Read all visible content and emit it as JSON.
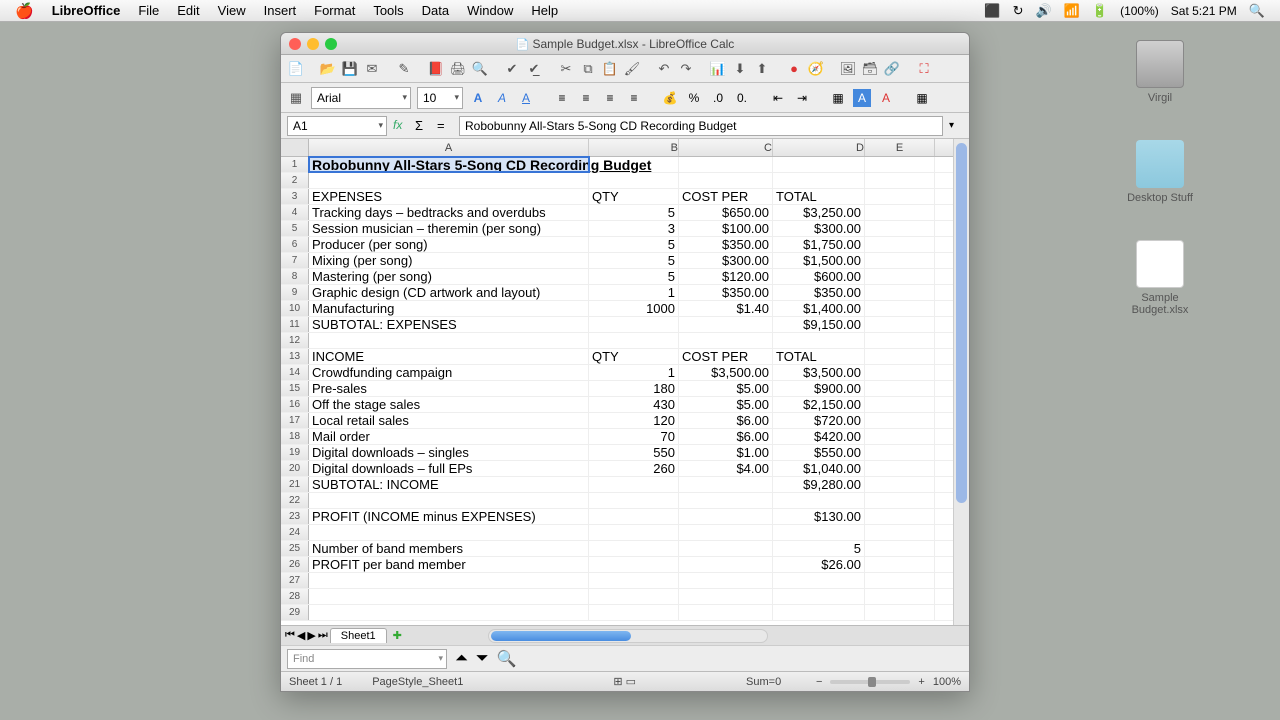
{
  "menubar": {
    "app": "LibreOffice",
    "items": [
      "File",
      "Edit",
      "View",
      "Insert",
      "Format",
      "Tools",
      "Data",
      "Window",
      "Help"
    ],
    "battery": "(100%)",
    "clock": "Sat 5:21 PM"
  },
  "desktop": {
    "hdd": "Virgil",
    "folder": "Desktop Stuff",
    "doc": "Sample Budget.xlsx"
  },
  "window": {
    "title": "Sample Budget.xlsx - LibreOffice Calc",
    "font": "Arial",
    "size": "10",
    "cellref": "A1",
    "formula": "Robobunny All-Stars 5-Song CD Recording Budget",
    "sheettab": "Sheet1",
    "find_placeholder": "Find",
    "status_sheet": "Sheet 1 / 1",
    "status_style": "PageStyle_Sheet1",
    "status_sum": "Sum=0",
    "status_zoom": "100%"
  },
  "columns": [
    "A",
    "B",
    "C",
    "D",
    "E"
  ],
  "rows": [
    {
      "n": 1,
      "A": "Robobunny All-Stars 5-Song CD Recording Budget"
    },
    {
      "n": 2
    },
    {
      "n": 3,
      "A": "EXPENSES",
      "B": "QTY",
      "C": "COST PER",
      "D": "TOTAL"
    },
    {
      "n": 4,
      "A": "Tracking days – bedtracks and overdubs",
      "B": "5",
      "C": "$650.00",
      "D": "$3,250.00"
    },
    {
      "n": 5,
      "A": "Session musician – theremin (per song)",
      "B": "3",
      "C": "$100.00",
      "D": "$300.00"
    },
    {
      "n": 6,
      "A": "Producer (per song)",
      "B": "5",
      "C": "$350.00",
      "D": "$1,750.00"
    },
    {
      "n": 7,
      "A": "Mixing (per song)",
      "B": "5",
      "C": "$300.00",
      "D": "$1,500.00"
    },
    {
      "n": 8,
      "A": "Mastering (per song)",
      "B": "5",
      "C": "$120.00",
      "D": "$600.00"
    },
    {
      "n": 9,
      "A": "Graphic design (CD artwork and layout)",
      "B": "1",
      "C": "$350.00",
      "D": "$350.00"
    },
    {
      "n": 10,
      "A": "Manufacturing",
      "B": "1000",
      "C": "$1.40",
      "D": "$1,400.00"
    },
    {
      "n": 11,
      "A": "SUBTOTAL: EXPENSES",
      "D": "$9,150.00"
    },
    {
      "n": 12
    },
    {
      "n": 13,
      "A": "INCOME",
      "B": "QTY",
      "C": "COST PER",
      "D": "TOTAL"
    },
    {
      "n": 14,
      "A": "Crowdfunding campaign",
      "B": "1",
      "C": "$3,500.00",
      "D": "$3,500.00"
    },
    {
      "n": 15,
      "A": "Pre-sales",
      "B": "180",
      "C": "$5.00",
      "D": "$900.00"
    },
    {
      "n": 16,
      "A": "Off the stage sales",
      "B": "430",
      "C": "$5.00",
      "D": "$2,150.00"
    },
    {
      "n": 17,
      "A": "Local retail sales",
      "B": "120",
      "C": "$6.00",
      "D": "$720.00"
    },
    {
      "n": 18,
      "A": "Mail order",
      "B": "70",
      "C": "$6.00",
      "D": "$420.00"
    },
    {
      "n": 19,
      "A": "Digital downloads – singles",
      "B": "550",
      "C": "$1.00",
      "D": "$550.00"
    },
    {
      "n": 20,
      "A": "Digital downloads – full EPs",
      "B": "260",
      "C": "$4.00",
      "D": "$1,040.00"
    },
    {
      "n": 21,
      "A": "SUBTOTAL: INCOME",
      "D": "$9,280.00"
    },
    {
      "n": 22
    },
    {
      "n": 23,
      "A": "PROFIT (INCOME minus EXPENSES)",
      "D": "$130.00"
    },
    {
      "n": 24
    },
    {
      "n": 25,
      "A": "Number of band members",
      "D": "5"
    },
    {
      "n": 26,
      "A": "PROFIT per band member",
      "D": "$26.00"
    },
    {
      "n": 27
    },
    {
      "n": 28
    },
    {
      "n": 29
    }
  ]
}
